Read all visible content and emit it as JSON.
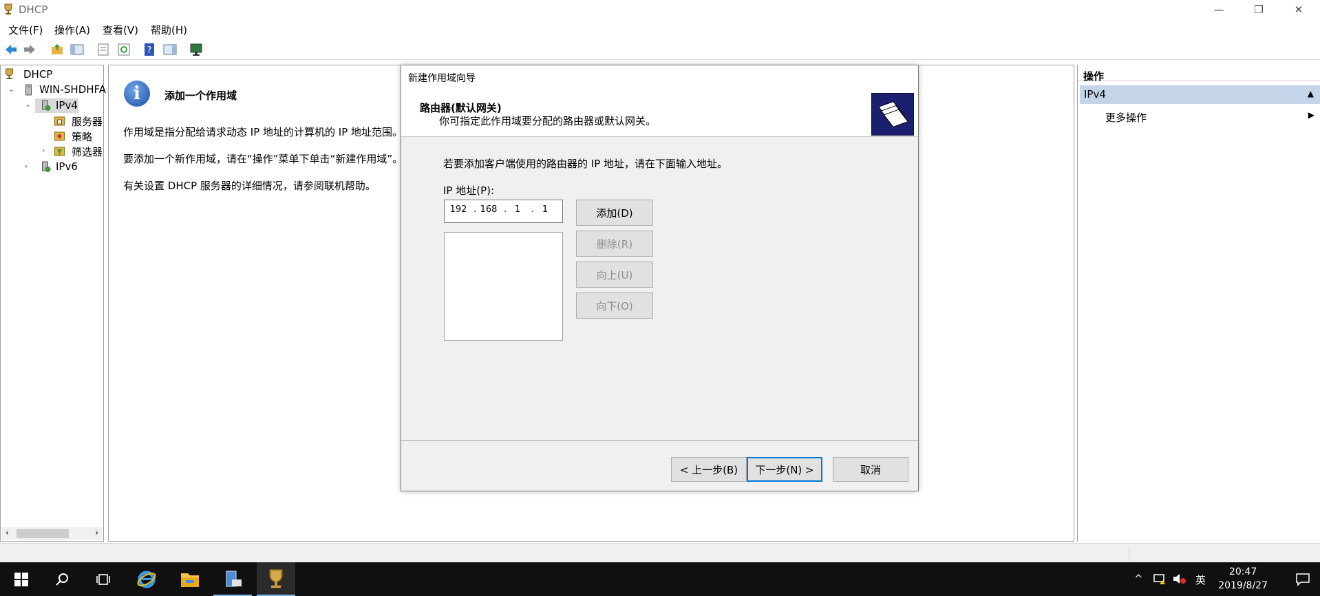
{
  "window": {
    "title": "DHCP",
    "buttons": {
      "minimize": "—",
      "restore": "❐",
      "close": "✕"
    }
  },
  "menu": [
    "文件(F)",
    "操作(A)",
    "查看(V)",
    "帮助(H)"
  ],
  "tree": {
    "root": "DHCP",
    "server": "WIN-SHDHFA",
    "ipv4": "IPv4",
    "ipv4_children": [
      "服务器",
      "策略",
      "筛选器"
    ],
    "ipv6": "IPv6"
  },
  "content": {
    "title": "添加一个作用域",
    "p1": "作用域是指分配给请求动态 IP 地址的计算机的 IP 地址范围。你",
    "p2": "要添加一个新作用域，请在“操作”菜单下单击“新建作用域”。",
    "p3": "有关设置 DHCP 服务器的详细情况，请参阅联机帮助。"
  },
  "actions": {
    "header": "操作",
    "selected": "IPv4",
    "more": "更多操作"
  },
  "dialog": {
    "title": "新建作用域向导",
    "heading": "路由器(默认网关)",
    "subheading": "你可指定此作用域要分配的路由器或默认网关。",
    "instruction": "若要添加客户端使用的路由器的 IP 地址，请在下面输入地址。",
    "ip_label": "IP 地址(P):",
    "ip_octets": [
      "192",
      "168",
      "1",
      "1"
    ],
    "buttons": {
      "add": "添加(D)",
      "remove": "删除(R)",
      "up": "向上(U)",
      "down": "向下(O)",
      "back": "< 上一步(B)",
      "next": "下一步(N) >",
      "cancel": "取消"
    }
  },
  "taskbar": {
    "tray_lang": "英",
    "time": "20:47",
    "date": "2019/8/27"
  }
}
